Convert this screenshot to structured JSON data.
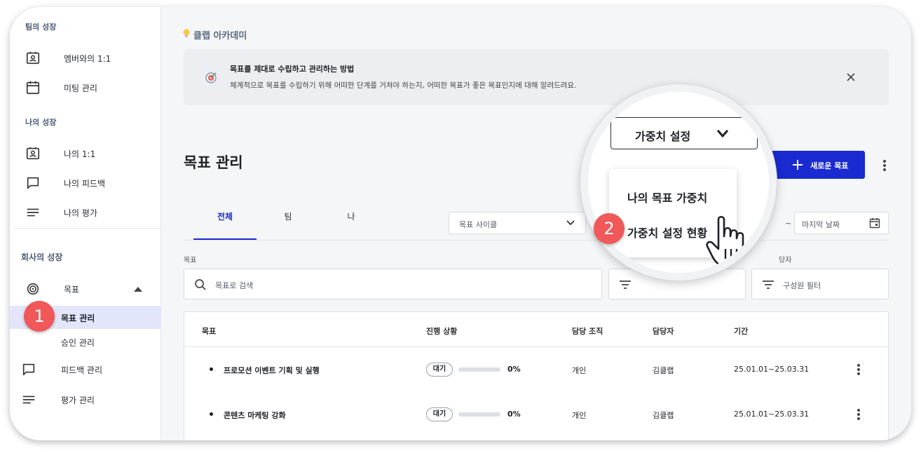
{
  "sidebar": {
    "team_growth": "팀의 성장",
    "team_items": [
      {
        "label": "멤버와의 1:1",
        "icon": "contact-card-icon"
      },
      {
        "label": "미팅 관리",
        "icon": "calendar-icon"
      }
    ],
    "my_growth": "나의 성장",
    "my_items": [
      {
        "label": "나의 1:1",
        "icon": "contact-card-icon"
      },
      {
        "label": "나의 피드백",
        "icon": "chat-bubble-icon"
      },
      {
        "label": "나의 평가",
        "icon": "lines-icon"
      }
    ],
    "company_growth": "회사의 성장",
    "goal_label": "목표",
    "goal_sub": [
      {
        "label": "목표 관리",
        "active": true
      },
      {
        "label": "승인 관리",
        "active": false
      }
    ],
    "feedback_admin": "피드백 관리",
    "eval_admin": "평가 관리"
  },
  "academy": {
    "title": "클랩 아카데미",
    "banner_title": "목표를 제대로 수립하고 관리하는 방법",
    "banner_desc": "체계적으로 목표를 수립하기 위해 어떠한 단계를 거쳐야 하는지, 어떠한 목표가 좋은 목표인지에 대해 알려드려요."
  },
  "page": {
    "title": "목표 관리",
    "new_goal_button": "새로운 목표"
  },
  "tabs": [
    "전체",
    "팀",
    "나"
  ],
  "filters": {
    "cycle_placeholder": "목표 사이클",
    "date_separator": "~",
    "end_date_placeholder": "마지막 날짜",
    "goal_label": "목표",
    "search_placeholder": "목표로 검색",
    "assignee_label_partial": "당자",
    "member_filter": "구성원 필터"
  },
  "table": {
    "columns": [
      "목표",
      "진행 상황",
      "담당 조직",
      "담당자",
      "기간"
    ],
    "rows": [
      {
        "goal": "프로모션 이벤트 기획 및 실행",
        "status": "대기",
        "progress": "0%",
        "org": "개인",
        "owner": "김클랩",
        "period": "25.01.01~25.03.31"
      },
      {
        "goal": "콘텐츠 마케팅 강화",
        "status": "대기",
        "progress": "0%",
        "org": "개인",
        "owner": "김클랩",
        "period": "25.01.01~25.03.31"
      }
    ]
  },
  "popup": {
    "dropdown_label": "가중치 설정",
    "menu_items": [
      "나의 목표 가중치",
      "가중치 설정 현황"
    ]
  },
  "steps": [
    "1",
    "2"
  ],
  "colors": {
    "accent": "#1a2bd1",
    "active_bg": "#e3e5fa",
    "step_badge": "#f0585a",
    "section_text": "#4a5a73"
  }
}
